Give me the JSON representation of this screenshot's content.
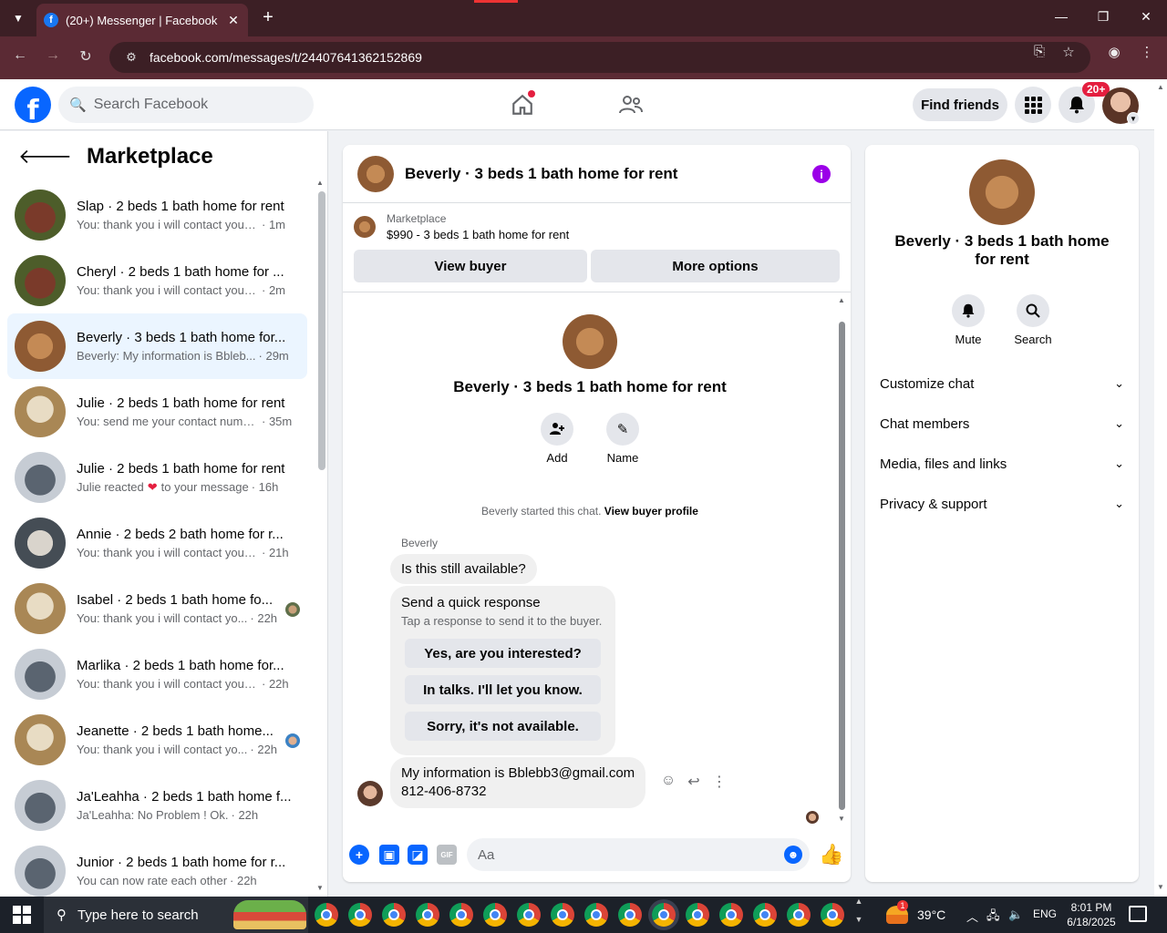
{
  "browser": {
    "tab_title": "(20+) Messenger | Facebook",
    "url": "facebook.com/messages/t/24407641362152869"
  },
  "fb": {
    "logo_letter": "f",
    "search_placeholder": "Search Facebook",
    "find_friends": "Find friends",
    "notif_badge": "20+"
  },
  "left": {
    "title": "Marketplace",
    "conversations": [
      {
        "title": "Slap · 2 beds 1 bath home for rent",
        "snippet": "You: thank you i will contact you s...",
        "time": "· 1m",
        "thumb": "red"
      },
      {
        "title": "Cheryl · 2 beds 1 bath home for ...",
        "snippet": "You: thank you i will contact you s...",
        "time": "· 2m",
        "thumb": "red"
      },
      {
        "title": "Beverly · 3 beds 1 bath home for...",
        "snippet": "Beverly: My information is Bbleb...",
        "time": "· 29m",
        "thumb": "wood"
      },
      {
        "title": "Julie · 2 beds 1 bath home for rent",
        "snippet": "You: send me your contact numb...",
        "time": "· 35m",
        "thumb": "tan"
      },
      {
        "title": "Julie · 2 beds 1 bath home for rent",
        "snippet": "Julie reacted",
        "snippet_after": "to your message",
        "time": "· 16h",
        "thumb": "gray"
      },
      {
        "title": "Annie · 2 beds 2 bath home for r...",
        "snippet": "You: thank you i will contact you s...",
        "time": "· 21h",
        "thumb": "room"
      },
      {
        "title": "Isabel · 2 beds 1 bath home fo...",
        "snippet": "You: thank you i will contact yo...",
        "time": "· 22h",
        "thumb": "tan"
      },
      {
        "title": "Marlika · 2 beds 1 bath home for...",
        "snippet": "You: thank you i will contact you s...",
        "time": "· 22h",
        "thumb": "gray"
      },
      {
        "title": "Jeanette · 2 beds 1 bath home...",
        "snippet": "You: thank you i will contact yo...",
        "time": "· 22h",
        "thumb": "tan"
      },
      {
        "title": "Ja'Leahha · 2 beds 1 bath home f...",
        "snippet": "Ja'Leahha: No Problem ! Ok.",
        "time": "· 22h",
        "thumb": "gray"
      },
      {
        "title": "Junior · 2 beds 1 bath home for r...",
        "snippet": "You can now rate each other",
        "time": "· 22h",
        "thumb": "gray"
      }
    ]
  },
  "chat": {
    "header_title": "Beverly · 3 beds 1 bath home for rent",
    "marketplace_label": "Marketplace",
    "listing_price": "$990 - 3 beds 1 bath home for rent",
    "view_buyer": "View buyer",
    "more_options": "More options",
    "hero_title": "Beverly · 3 beds 1 bath home for rent",
    "add_label": "Add",
    "name_label": "Name",
    "started_text": "Beverly started this chat.",
    "view_buyer_profile": "View buyer profile",
    "sender_name": "Beverly",
    "msg1": "Is this still available?",
    "quick_title": "Send a quick response",
    "quick_sub": "Tap a response to send it to the buyer.",
    "quick_replies": [
      "Yes, are you interested?",
      "In talks. I'll let you know.",
      "Sorry, it's not available."
    ],
    "msg2_line1": "My information is Bblebb3@gmail.com",
    "msg2_line2": "812-406-8732",
    "composer_placeholder": "Aa"
  },
  "details": {
    "title": "Beverly · 3 beds 1 bath home for rent",
    "mute": "Mute",
    "search": "Search",
    "sections": [
      "Customize chat",
      "Chat members",
      "Media, files and links",
      "Privacy & support"
    ]
  },
  "taskbar": {
    "search_placeholder": "Type here to search",
    "temperature": "39°C",
    "weather_alert": "1",
    "language": "ENG",
    "time": "8:01 PM",
    "date": "6/18/2025"
  }
}
